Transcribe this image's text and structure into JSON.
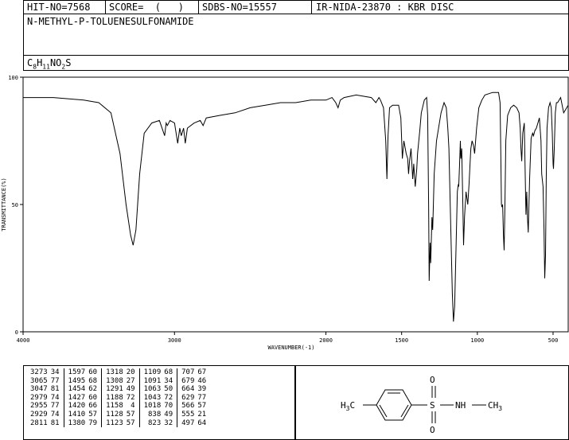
{
  "header": {
    "hit_no": "HIT-NO=7568",
    "score": "SCORE=  (   )",
    "sdbs_no": "SDBS-NO=15557",
    "ir_nida": "IR-NIDA-23870 : KBR DISC",
    "compound_name": "N-METHYL-P-TOLUENESULFONAMIDE",
    "formula_c": "C",
    "formula_c_sub": "8",
    "formula_h": "H",
    "formula_h_sub": "11",
    "formula_no": "NO",
    "formula_o_sub": "2",
    "formula_s": "S"
  },
  "chart_data": {
    "type": "line",
    "xlabel": "WAVENUMBER(-1)",
    "ylabel": "TRANSMITTANCE(%)",
    "xlim": [
      4000,
      400
    ],
    "ylim": [
      0,
      100
    ],
    "x_ticks": [
      4000,
      3000,
      2000,
      1500,
      1000,
      500
    ],
    "y_ticks": [
      0,
      50,
      100
    ],
    "x_tick_labels": [
      "4000",
      "3000",
      "2000",
      "1500",
      "1000",
      "500"
    ],
    "y_tick_labels": [
      "0",
      "50",
      "100"
    ],
    "series": [
      {
        "color": "#000000",
        "points": [
          [
            4000,
            92
          ],
          [
            3800,
            92
          ],
          [
            3600,
            91
          ],
          [
            3500,
            90
          ],
          [
            3420,
            86
          ],
          [
            3360,
            70
          ],
          [
            3320,
            50
          ],
          [
            3290,
            38
          ],
          [
            3273,
            34
          ],
          [
            3255,
            40
          ],
          [
            3230,
            62
          ],
          [
            3200,
            78
          ],
          [
            3150,
            82
          ],
          [
            3100,
            83
          ],
          [
            3065,
            77
          ],
          [
            3055,
            82
          ],
          [
            3047,
            81
          ],
          [
            3030,
            83
          ],
          [
            3000,
            82
          ],
          [
            2979,
            74
          ],
          [
            2965,
            80
          ],
          [
            2955,
            77
          ],
          [
            2940,
            80
          ],
          [
            2929,
            74
          ],
          [
            2915,
            80
          ],
          [
            2870,
            82
          ],
          [
            2830,
            83
          ],
          [
            2811,
            81
          ],
          [
            2790,
            84
          ],
          [
            2700,
            85
          ],
          [
            2600,
            86
          ],
          [
            2500,
            88
          ],
          [
            2400,
            89
          ],
          [
            2300,
            90
          ],
          [
            2200,
            90
          ],
          [
            2100,
            91
          ],
          [
            2000,
            91
          ],
          [
            1960,
            92
          ],
          [
            1935,
            90
          ],
          [
            1920,
            88
          ],
          [
            1905,
            91
          ],
          [
            1880,
            92
          ],
          [
            1800,
            93
          ],
          [
            1700,
            92
          ],
          [
            1670,
            90
          ],
          [
            1650,
            92
          ],
          [
            1640,
            91
          ],
          [
            1620,
            88
          ],
          [
            1605,
            75
          ],
          [
            1597,
            60
          ],
          [
            1590,
            77
          ],
          [
            1580,
            88
          ],
          [
            1560,
            89
          ],
          [
            1520,
            89
          ],
          [
            1505,
            84
          ],
          [
            1495,
            68
          ],
          [
            1485,
            75
          ],
          [
            1470,
            70
          ],
          [
            1460,
            68
          ],
          [
            1454,
            62
          ],
          [
            1448,
            67
          ],
          [
            1438,
            72
          ],
          [
            1427,
            60
          ],
          [
            1422,
            64
          ],
          [
            1420,
            66
          ],
          [
            1414,
            60
          ],
          [
            1410,
            57
          ],
          [
            1400,
            64
          ],
          [
            1395,
            70
          ],
          [
            1380,
            79
          ],
          [
            1370,
            86
          ],
          [
            1350,
            91
          ],
          [
            1335,
            92
          ],
          [
            1328,
            85
          ],
          [
            1322,
            50
          ],
          [
            1318,
            20
          ],
          [
            1312,
            35
          ],
          [
            1308,
            27
          ],
          [
            1300,
            45
          ],
          [
            1295,
            40
          ],
          [
            1291,
            49
          ],
          [
            1285,
            62
          ],
          [
            1270,
            75
          ],
          [
            1240,
            86
          ],
          [
            1220,
            90
          ],
          [
            1205,
            88
          ],
          [
            1195,
            80
          ],
          [
            1188,
            72
          ],
          [
            1175,
            40
          ],
          [
            1165,
            15
          ],
          [
            1158,
            4
          ],
          [
            1150,
            10
          ],
          [
            1140,
            35
          ],
          [
            1132,
            55
          ],
          [
            1128,
            57
          ],
          [
            1125,
            58
          ],
          [
            1123,
            57
          ],
          [
            1118,
            65
          ],
          [
            1112,
            75
          ],
          [
            1109,
            68
          ],
          [
            1103,
            72
          ],
          [
            1096,
            50
          ],
          [
            1091,
            34
          ],
          [
            1085,
            45
          ],
          [
            1075,
            55
          ],
          [
            1063,
            50
          ],
          [
            1055,
            58
          ],
          [
            1045,
            70
          ],
          [
            1043,
            72
          ],
          [
            1035,
            75
          ],
          [
            1025,
            73
          ],
          [
            1018,
            70
          ],
          [
            1005,
            80
          ],
          [
            990,
            88
          ],
          [
            970,
            91
          ],
          [
            950,
            93
          ],
          [
            900,
            94
          ],
          [
            860,
            94
          ],
          [
            850,
            90
          ],
          [
            845,
            70
          ],
          [
            841,
            50
          ],
          [
            838,
            49
          ],
          [
            833,
            50
          ],
          [
            828,
            38
          ],
          [
            823,
            32
          ],
          [
            818,
            50
          ],
          [
            812,
            75
          ],
          [
            800,
            85
          ],
          [
            780,
            88
          ],
          [
            760,
            89
          ],
          [
            740,
            88
          ],
          [
            725,
            86
          ],
          [
            717,
            80
          ],
          [
            712,
            72
          ],
          [
            707,
            67
          ],
          [
            700,
            78
          ],
          [
            690,
            82
          ],
          [
            679,
            46
          ],
          [
            674,
            55
          ],
          [
            669,
            45
          ],
          [
            664,
            39
          ],
          [
            655,
            60
          ],
          [
            645,
            76
          ],
          [
            635,
            78
          ],
          [
            629,
            77
          ],
          [
            620,
            79
          ],
          [
            610,
            80
          ],
          [
            600,
            82
          ],
          [
            590,
            84
          ],
          [
            580,
            75
          ],
          [
            575,
            62
          ],
          [
            566,
            57
          ],
          [
            560,
            40
          ],
          [
            555,
            21
          ],
          [
            550,
            30
          ],
          [
            545,
            60
          ],
          [
            540,
            80
          ],
          [
            530,
            88
          ],
          [
            520,
            90
          ],
          [
            512,
            88
          ],
          [
            505,
            78
          ],
          [
            500,
            66
          ],
          [
            497,
            64
          ],
          [
            492,
            72
          ],
          [
            485,
            86
          ],
          [
            478,
            90
          ],
          [
            470,
            90
          ],
          [
            460,
            91
          ],
          [
            450,
            92
          ],
          [
            440,
            89
          ],
          [
            430,
            86
          ],
          [
            420,
            87
          ],
          [
            410,
            88
          ],
          [
            400,
            89
          ]
        ]
      }
    ],
    "peak_table": [
      [
        3273,
        34,
        1597,
        60,
        1318,
        20,
        1109,
        68,
        707,
        67
      ],
      [
        3065,
        77,
        1495,
        68,
        1308,
        27,
        1091,
        34,
        679,
        46
      ],
      [
        3047,
        81,
        1454,
        62,
        1291,
        49,
        1063,
        50,
        664,
        39
      ],
      [
        2979,
        74,
        1427,
        60,
        1188,
        72,
        1043,
        72,
        629,
        77
      ],
      [
        2955,
        77,
        1420,
        66,
        1158,
        4,
        1018,
        70,
        566,
        57
      ],
      [
        2929,
        74,
        1410,
        57,
        1128,
        57,
        838,
        49,
        555,
        21
      ],
      [
        2811,
        81,
        1380,
        79,
        1123,
        57,
        823,
        32,
        497,
        64
      ]
    ]
  },
  "structure": {
    "left_group": "H",
    "left_sub": "3",
    "left_c": "C",
    "sulfur": "S",
    "oxygen_top": "O",
    "oxygen_bottom": "O",
    "nh": "NH",
    "right_group": "CH",
    "right_sub": "3"
  }
}
